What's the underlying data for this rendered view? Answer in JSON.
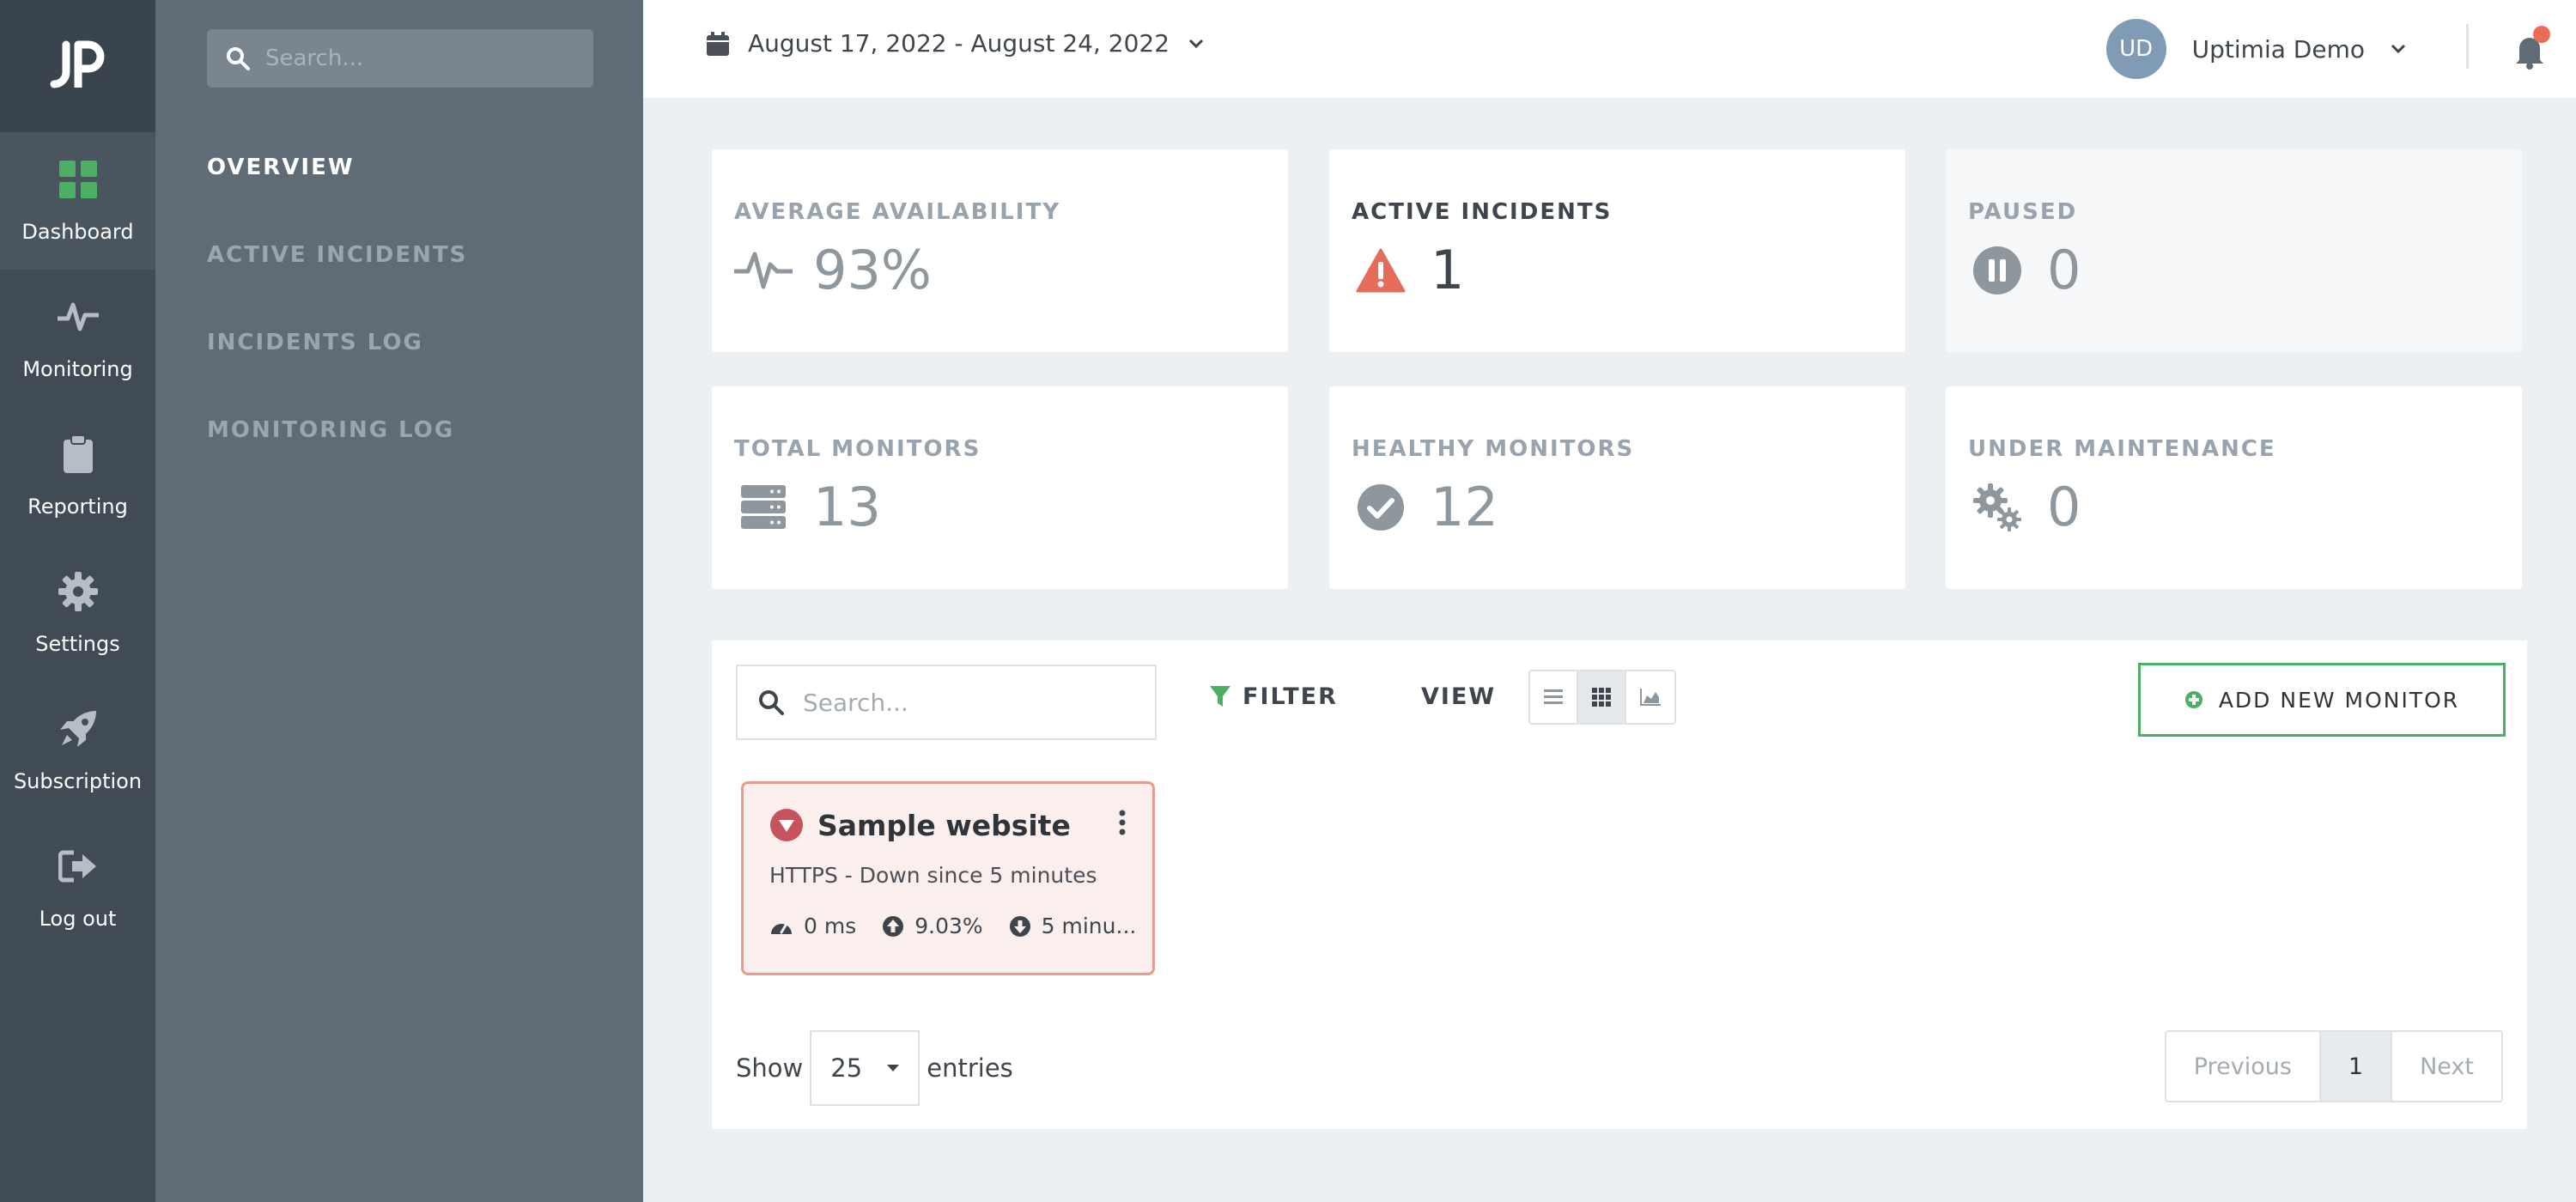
{
  "rail": {
    "items": [
      {
        "label": "Dashboard",
        "icon": "dashboard-grid-icon",
        "active": true
      },
      {
        "label": "Monitoring",
        "icon": "pulse-icon"
      },
      {
        "label": "Reporting",
        "icon": "clipboard-icon"
      },
      {
        "label": "Settings",
        "icon": "gear-icon"
      },
      {
        "label": "Subscription",
        "icon": "rocket-icon"
      },
      {
        "label": "Log out",
        "icon": "sign-out-icon"
      }
    ]
  },
  "subnav": {
    "search_placeholder": "Search...",
    "links": [
      "OVERVIEW",
      "ACTIVE INCIDENTS",
      "INCIDENTS LOG",
      "MONITORING LOG"
    ],
    "active_index": 0
  },
  "topbar": {
    "date_range": "August 17, 2022 - August 24, 2022",
    "avatar_initials": "UD",
    "user_name": "Uptimia Demo",
    "notification_dot_color": "#ee6b57"
  },
  "stats": [
    {
      "label": "AVERAGE AVAILABILITY",
      "value": "93%",
      "icon": "heartbeat-icon"
    },
    {
      "label": "ACTIVE INCIDENTS",
      "value": "1",
      "icon": "warning-icon"
    },
    {
      "label": "PAUSED",
      "value": "0",
      "icon": "pause-icon"
    },
    {
      "label": "TOTAL MONITORS",
      "value": "13",
      "icon": "server-icon"
    },
    {
      "label": "HEALTHY MONITORS",
      "value": "12",
      "icon": "check-circle-icon"
    },
    {
      "label": "UNDER MAINTENANCE",
      "value": "0",
      "icon": "gears-icon"
    }
  ],
  "monitors_panel": {
    "search_placeholder": "Search...",
    "filter_label": "FILTER",
    "view_label": "VIEW",
    "add_button_label": "ADD NEW MONITOR",
    "monitor": {
      "name": "Sample website",
      "status": "HTTPS - Down since 5 minutes",
      "response_time": "0 ms",
      "uptime": "9.03%",
      "downtime": "5 minu..."
    },
    "show_label": "Show",
    "page_size": "25",
    "entries_label": "entries",
    "pagination": {
      "previous": "Previous",
      "current": "1",
      "next": "Next"
    }
  },
  "colors": {
    "accent_green": "#4caf64",
    "danger": "#e36c5a",
    "rail_bg": "#404b55",
    "subnav_bg": "#5f6c77"
  }
}
